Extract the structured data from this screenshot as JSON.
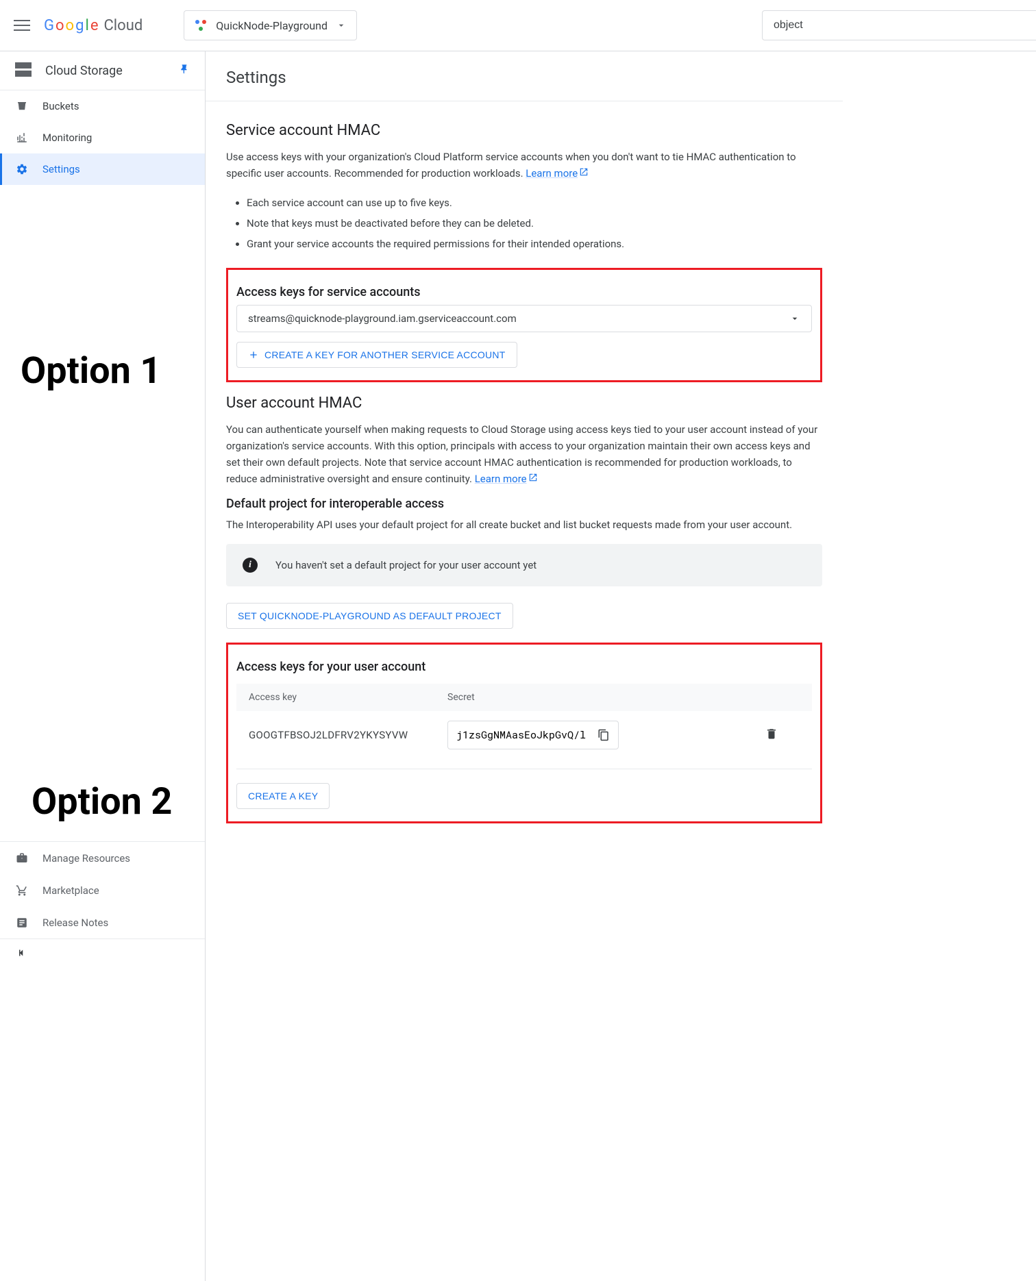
{
  "header": {
    "project_name": "QuickNode-Playground",
    "search_value": "object"
  },
  "sidebar": {
    "product": "Cloud Storage",
    "items": [
      {
        "label": "Buckets",
        "icon": "bucket"
      },
      {
        "label": "Monitoring",
        "icon": "monitoring"
      },
      {
        "label": "Settings",
        "icon": "gear"
      }
    ],
    "footer_items": [
      {
        "label": "Manage Resources",
        "icon": "briefcase"
      },
      {
        "label": "Marketplace",
        "icon": "cart"
      },
      {
        "label": "Release Notes",
        "icon": "notes"
      }
    ]
  },
  "overlays": {
    "option1": "Option 1",
    "option2": "Option 2"
  },
  "main": {
    "page_title": "Settings",
    "service_hmac": {
      "heading": "Service account HMAC",
      "desc": "Use access keys with your organization's Cloud Platform service accounts when you don't want to tie HMAC authentication to specific user accounts. Recommended for production workloads.",
      "learn_more": "Learn more",
      "bullets": [
        "Each service account can use up to five keys.",
        "Note that keys must be deactivated before they can be deleted.",
        "Grant your service accounts the required permissions for their intended operations."
      ],
      "access_keys_heading": "Access keys for service accounts",
      "selected_account": "streams@quicknode-playground.iam.gserviceaccount.com",
      "create_key_label": "CREATE A KEY FOR ANOTHER SERVICE ACCOUNT"
    },
    "user_hmac": {
      "heading": "User account HMAC",
      "desc": "You can authenticate yourself when making requests to Cloud Storage using access keys tied to your user account instead of your organization's service accounts. With this option, principals with access to your organization maintain their own access keys and set their own default projects. Note that service account HMAC authentication is recommended for production workloads, to reduce administrative oversight and ensure continuity.",
      "learn_more": "Learn more"
    },
    "default_project": {
      "heading": "Default project for interoperable access",
      "desc": "The Interoperability API uses your default project for all create bucket and list bucket requests made from your user account.",
      "info_msg": "You haven't set a default project for your user account yet",
      "set_default_btn": "SET QUICKNODE-PLAYGROUND AS DEFAULT PROJECT"
    },
    "user_keys": {
      "heading": "Access keys for your user account",
      "col_access": "Access key",
      "col_secret": "Secret",
      "access_key_value": "GOOGTFBSOJ2LDFRV2YKYSYVW",
      "secret_value": "j1zsGgNMAasEoJkpGvQ/l",
      "create_key_btn": "CREATE A KEY"
    }
  }
}
